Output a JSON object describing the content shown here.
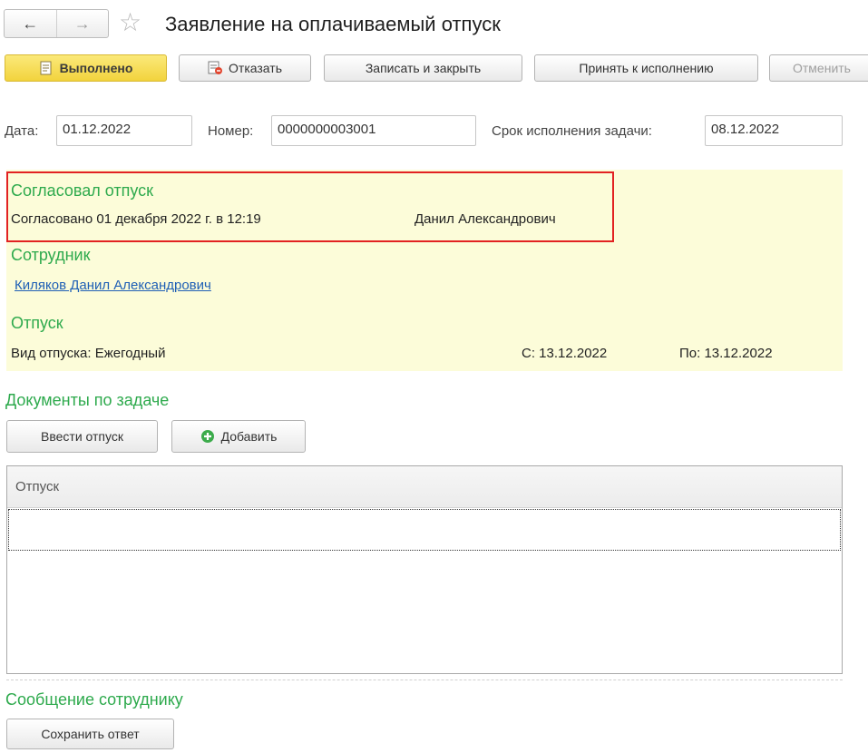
{
  "header": {
    "back_icon": "←",
    "forward_icon": "→",
    "star_icon": "☆",
    "title": "Заявление на оплачиваемый отпуск"
  },
  "toolbar": {
    "done_label": "Выполнено",
    "reject_label": "Отказать",
    "save_close_label": "Записать и закрыть",
    "accept_label": "Принять к исполнению",
    "cancel_label": "Отменить"
  },
  "fields": {
    "date_label": "Дата:",
    "date_value": "01.12.2022",
    "number_label": "Номер:",
    "number_value": "0000000003001",
    "deadline_label": "Срок исполнения задачи:",
    "deadline_value": "08.12.2022"
  },
  "approval": {
    "heading": "Согласовал отпуск",
    "text": "Согласовано 01 декабря 2022 г. в 12:19",
    "approver": "Данил Александрович"
  },
  "employee": {
    "heading": "Сотрудник",
    "name": "Киляков Данил Александрович"
  },
  "vacation": {
    "heading": "Отпуск",
    "type_text": "Вид отпуска: Ежегодный",
    "from_text": "С: 13.12.2022",
    "to_text": "По: 13.12.2022"
  },
  "documents": {
    "heading": "Документы по задаче",
    "enter_vacation_label": "Ввести отпуск",
    "add_label": "Добавить",
    "columns": [
      "Отпуск"
    ]
  },
  "message": {
    "heading": "Сообщение сотруднику",
    "save_reply_label": "Сохранить ответ"
  },
  "colors": {
    "accent_green": "#2eaa4d",
    "panel_yellow": "#fcfcd9",
    "highlight_red": "#e22222",
    "link_blue": "#1f5fb5"
  }
}
